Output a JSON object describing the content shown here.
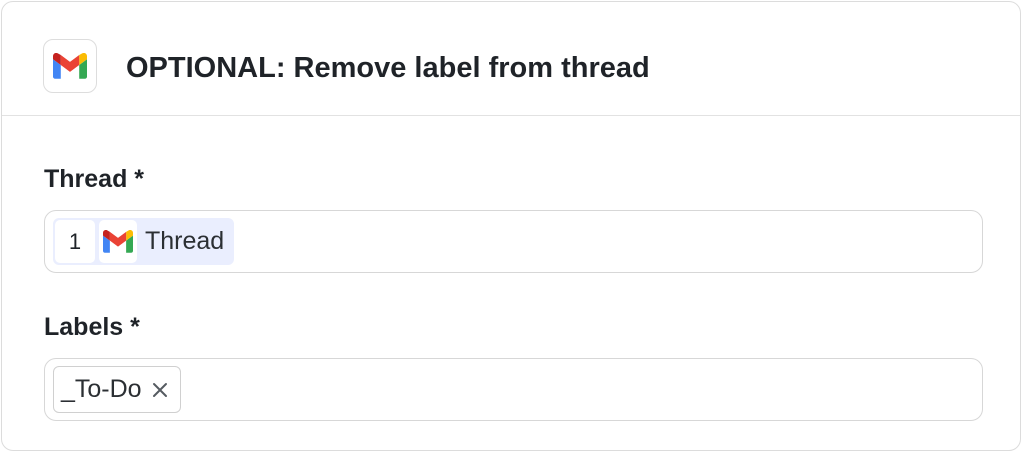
{
  "header": {
    "app_icon": "gmail-icon",
    "title": "OPTIONAL: Remove label from thread"
  },
  "fields": {
    "thread": {
      "label": "Thread *",
      "value": {
        "step_number": "1",
        "icon": "gmail-icon",
        "text": "Thread"
      }
    },
    "labels": {
      "label": "Labels *",
      "tags": [
        {
          "text": "_To-Do",
          "remove_icon": "close-icon"
        }
      ]
    }
  },
  "colors": {
    "gmail_red": "#ea4335",
    "gmail_blue": "#4285f4",
    "gmail_green": "#34a853",
    "gmail_yellow": "#fbbc04",
    "gmail_dark_red": "#c5221f",
    "pill_background": "#eaeefe"
  }
}
